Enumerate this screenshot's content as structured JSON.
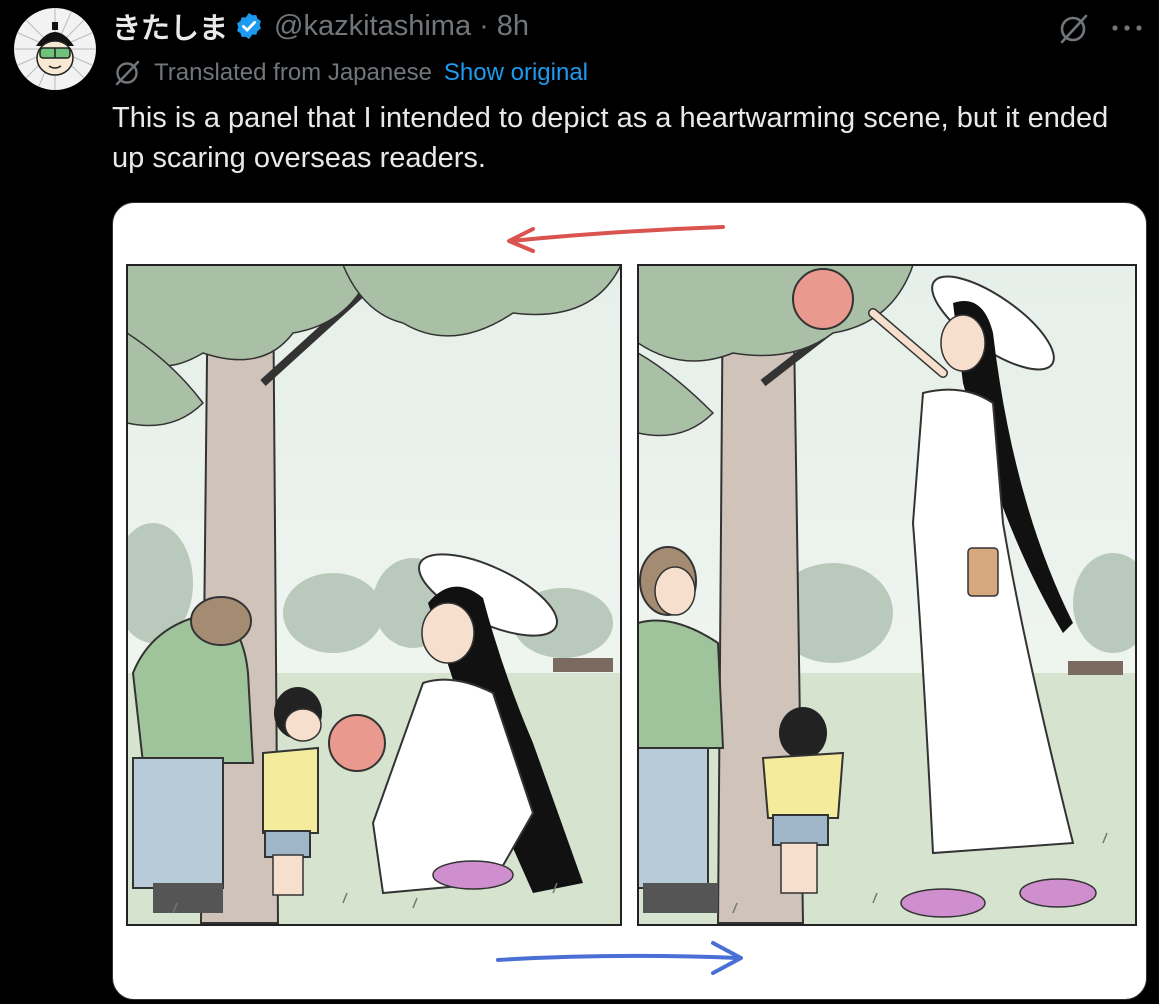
{
  "tweet": {
    "display_name": "きたしま",
    "handle": "@kazkitashima",
    "separator": "·",
    "time": "8h",
    "translation_note": "Translated from Japanese",
    "show_original_label": "Show original",
    "text": "This is a panel that I intended to depict as a heartwarming scene, but it ended up scaring overseas readers."
  },
  "icons": {
    "verified": "verified-badge-icon",
    "grok": "grok-icon",
    "more": "more-dots-icon",
    "translate": "translate-slash-icon"
  },
  "colors": {
    "background": "#000000",
    "text_primary": "#e7e9ea",
    "text_secondary": "#71767b",
    "link": "#1d9bf0",
    "verified": "#1d9bf0",
    "arrow_top": "#d9534f",
    "arrow_bottom": "#4a6fd4"
  }
}
